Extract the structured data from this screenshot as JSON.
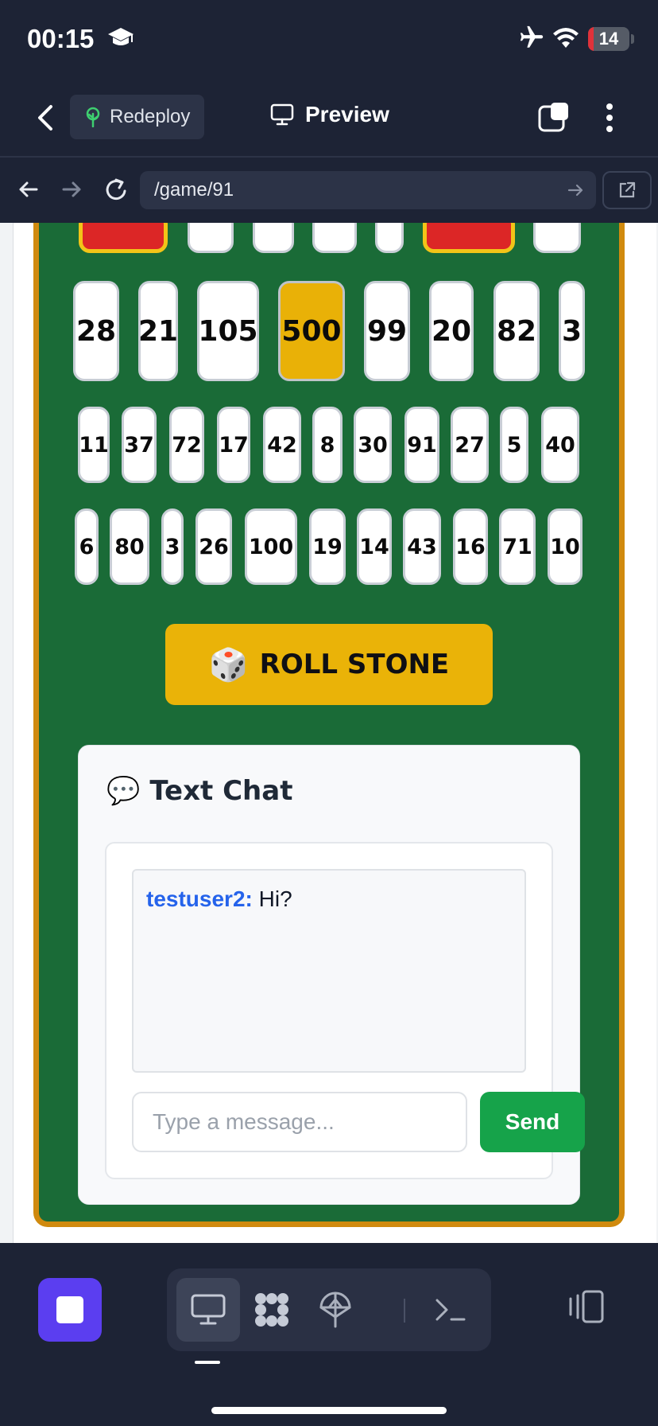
{
  "status_bar": {
    "time": "00:15",
    "battery": "14",
    "battery_level_pct": 14,
    "icons": [
      "graduation-cap-icon",
      "airplane-icon",
      "wifi-icon",
      "battery-icon"
    ]
  },
  "app_bar": {
    "redeploy_label": "Redeploy",
    "preview_label": "Preview"
  },
  "url_bar": {
    "url": "/game/91"
  },
  "board": {
    "top_row_partial": [
      {
        "value": "",
        "style": "red"
      },
      {
        "value": "",
        "style": "white"
      },
      {
        "value": "",
        "style": "white"
      },
      {
        "value": "",
        "style": "white"
      },
      {
        "value": "",
        "style": "white"
      },
      {
        "value": "",
        "style": "red"
      },
      {
        "value": "",
        "style": "white"
      }
    ],
    "row1": [
      "28",
      "21",
      "105",
      "500",
      "99",
      "20",
      "82",
      "3"
    ],
    "row1_highlight": "500",
    "row2": [
      "11",
      "37",
      "72",
      "17",
      "42",
      "8",
      "30",
      "91",
      "27",
      "5",
      "40"
    ],
    "row3": [
      "6",
      "80",
      "3",
      "26",
      "100",
      "19",
      "14",
      "43",
      "16",
      "71",
      "10"
    ],
    "colors": {
      "felt": "#1a6b37",
      "rim": "#d08a0e",
      "gold": "#e9b107",
      "red": "#dc2626"
    }
  },
  "roll_button": {
    "icon": "🎲",
    "label": "ROLL STONE"
  },
  "chat": {
    "icon": "💬",
    "title": "Text Chat",
    "messages": [
      {
        "user": "testuser2:",
        "text": " Hi?"
      }
    ],
    "input_placeholder": "Type a message...",
    "send_label": "Send"
  },
  "bottom_bar": {
    "modes": [
      "desktop-icon",
      "grid-icon",
      "deploy-icon",
      "terminal-icon"
    ],
    "active_mode": "desktop-icon"
  }
}
